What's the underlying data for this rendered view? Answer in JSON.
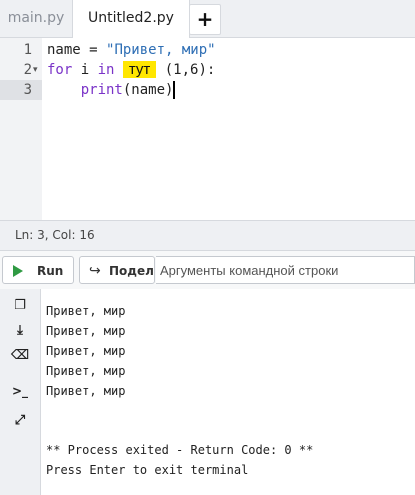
{
  "tabs": [
    {
      "label": "main.py",
      "active": false
    },
    {
      "label": "Untitled2.py",
      "active": true
    }
  ],
  "add_tab_label": "+",
  "editor": {
    "line_numbers": [
      "1",
      "2",
      "3"
    ],
    "line1": {
      "name": "name",
      "eq": " = ",
      "str": "\"Привет, мир\""
    },
    "line2": {
      "kw_for": "for",
      "var": " i ",
      "kw_in": "in",
      "highlight": "тут",
      "rest": " (1,6):"
    },
    "line3": {
      "indent": "    ",
      "fn": "print",
      "args": "(name)"
    }
  },
  "status": {
    "text": "Ln: 3,  Col: 16"
  },
  "toolbar": {
    "run_label": "Run",
    "share_label": "Поделиться",
    "args_placeholder": "Аргументы командной строки"
  },
  "console": {
    "output": [
      "Привет, мир",
      "Привет, мир",
      "Привет, мир",
      "Привет, мир",
      "Привет, мир"
    ],
    "exit_message": "** Process exited - Return Code: 0 **",
    "prompt": "Press Enter to exit terminal"
  },
  "colors": {
    "run_icon": "#2f9a43",
    "highlight": "#ffe600",
    "keyword": "#7a33c8",
    "string": "#2f6fb5"
  }
}
